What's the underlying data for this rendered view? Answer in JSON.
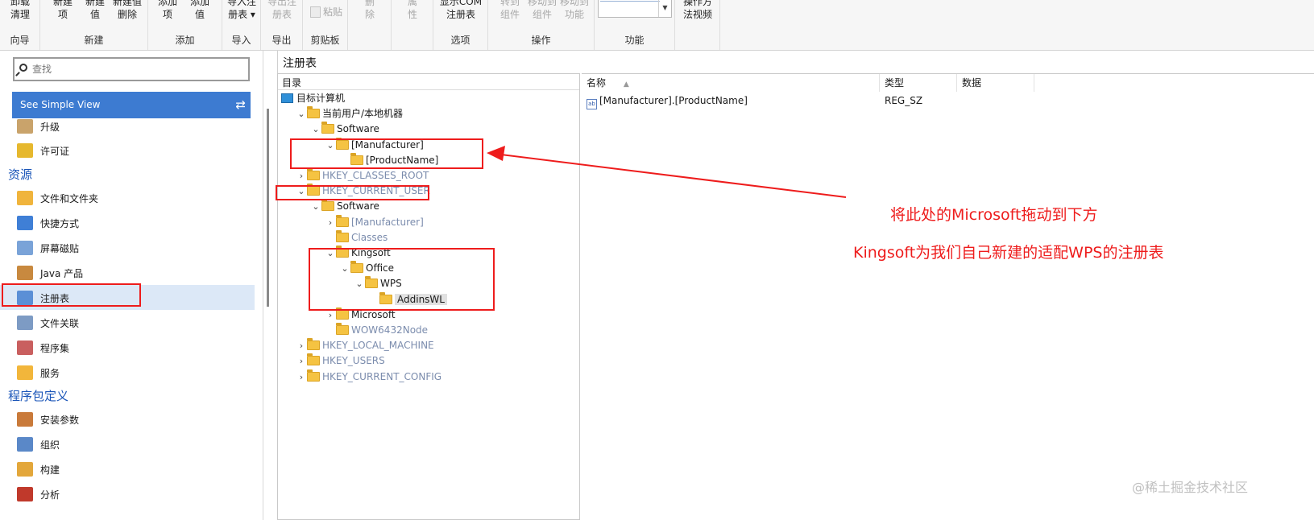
{
  "ribbon": {
    "groups": [
      {
        "label": "向导",
        "buttons": [
          {
            "label": "卸载\n清理",
            "enabled": true
          }
        ]
      },
      {
        "label": "新建",
        "buttons": [
          {
            "label": "新建\n项",
            "enabled": true
          },
          {
            "label": "新建\n值",
            "enabled": true
          },
          {
            "label": "新建值\n删除",
            "enabled": true
          }
        ]
      },
      {
        "label": "添加",
        "buttons": [
          {
            "label": "添加\n项",
            "enabled": true
          },
          {
            "label": "添加\n值",
            "enabled": true
          }
        ]
      },
      {
        "label": "导入",
        "buttons": [
          {
            "label": "导入注\n册表 ▾",
            "enabled": true
          }
        ]
      },
      {
        "label": "导出",
        "buttons": [
          {
            "label": "导出注\n册表",
            "enabled": false
          }
        ]
      },
      {
        "label": "剪贴板",
        "paste": "粘贴"
      },
      {
        "label": "",
        "buttons": [
          {
            "label": "删\n除",
            "enabled": false
          }
        ]
      },
      {
        "label": "",
        "buttons": [
          {
            "label": "属\n性",
            "enabled": false
          }
        ]
      },
      {
        "label": "选项",
        "buttons": [
          {
            "label": "显示COM\n注册表",
            "enabled": true
          }
        ]
      },
      {
        "label": "操作",
        "buttons": [
          {
            "label": "转到\n组件",
            "enabled": false
          },
          {
            "label": "移动到\n组件",
            "enabled": false
          },
          {
            "label": "移动到\n功能",
            "enabled": false
          }
        ]
      },
      {
        "label": "功能",
        "combo": true
      },
      {
        "label": "",
        "buttons": [
          {
            "label": "操作方\n法视频",
            "enabled": true
          }
        ]
      }
    ]
  },
  "nav": {
    "search_placeholder": "查找",
    "simple_view": "See Simple View",
    "swap_icon": "⇄",
    "items_top": [
      "升级",
      "许可证"
    ],
    "section_resources": "资源",
    "items_resources": [
      "文件和文件夹",
      "快捷方式",
      "屏幕磁贴",
      "Java 产品",
      "注册表",
      "文件关联",
      "程序集",
      "服务"
    ],
    "selected": "注册表",
    "section_package": "程序包定义",
    "items_package": [
      "安装参数",
      "组织",
      "构建",
      "分析"
    ]
  },
  "main": {
    "title": "注册表",
    "tree_header": "目录",
    "tree": [
      {
        "label": "目标计算机",
        "type": "computer",
        "depth": 0,
        "chev": ""
      },
      {
        "label": "当前用户/本地机器",
        "depth": 1,
        "chev": "⌄",
        "gray": false
      },
      {
        "label": "Software",
        "depth": 2,
        "chev": "⌄",
        "gray": false
      },
      {
        "label": "[Manufacturer]",
        "depth": 3,
        "chev": "⌄",
        "gray": false
      },
      {
        "label": "[ProductName]",
        "depth": 4,
        "chev": "",
        "gray": false
      },
      {
        "label": "HKEY_CLASSES_ROOT",
        "depth": 1,
        "chev": "›",
        "gray": true
      },
      {
        "label": "HKEY_CURRENT_USER",
        "depth": 1,
        "chev": "⌄",
        "gray": true
      },
      {
        "label": "Software",
        "depth": 2,
        "chev": "⌄",
        "gray": false
      },
      {
        "label": "[Manufacturer]",
        "depth": 3,
        "chev": "›",
        "gray": true
      },
      {
        "label": "Classes",
        "depth": 3,
        "chev": "",
        "gray": true
      },
      {
        "label": "Kingsoft",
        "depth": 3,
        "chev": "⌄",
        "gray": false
      },
      {
        "label": "Office",
        "depth": 4,
        "chev": "⌄",
        "gray": false
      },
      {
        "label": "WPS",
        "depth": 5,
        "chev": "⌄",
        "gray": false
      },
      {
        "label": "AddinsWL",
        "depth": 6,
        "chev": "",
        "gray": false,
        "highlight": true
      },
      {
        "label": "Microsoft",
        "depth": 3,
        "chev": "›",
        "gray": false
      },
      {
        "label": "WOW6432Node",
        "depth": 3,
        "chev": "",
        "gray": true
      },
      {
        "label": "HKEY_LOCAL_MACHINE",
        "depth": 1,
        "chev": "›",
        "gray": true
      },
      {
        "label": "HKEY_USERS",
        "depth": 1,
        "chev": "›",
        "gray": true
      },
      {
        "label": "HKEY_CURRENT_CONFIG",
        "depth": 1,
        "chev": "›",
        "gray": true
      }
    ],
    "list_headers": {
      "name": "名称",
      "sort": "▲",
      "type": "类型",
      "data": "数据"
    },
    "list_rows": [
      {
        "icon": "ab",
        "name": "[Manufacturer].[ProductName]",
        "type": "REG_SZ",
        "data": ""
      }
    ]
  },
  "annotations": {
    "arrow_note": "将此处的Microsoft拖动到下方",
    "kingsoft_note": "Kingsoft为我们自己新建的适配WPS的注册表",
    "color": "#ee1c1c"
  },
  "watermark": "@稀土掘金技术社区"
}
